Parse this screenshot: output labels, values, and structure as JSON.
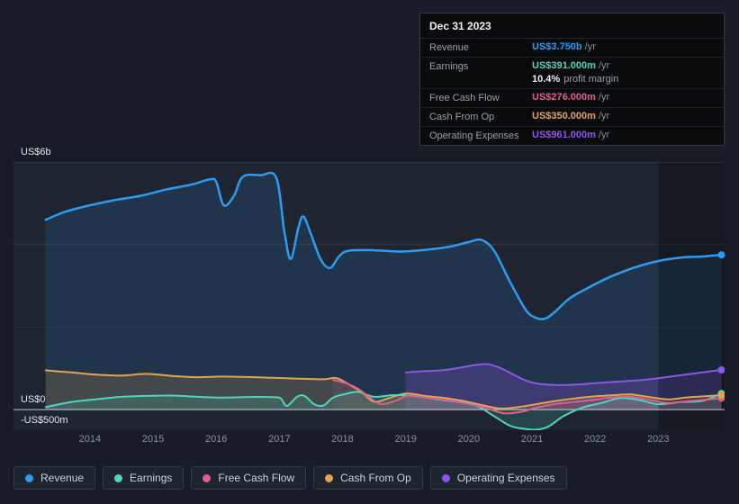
{
  "tooltip": {
    "title": "Dec 31 2023",
    "rows": [
      {
        "label": "Revenue",
        "value": "US$3.750b",
        "suffix": "/yr"
      },
      {
        "label": "Earnings",
        "value": "US$391.000m",
        "suffix": "/yr"
      },
      {
        "label": "Free Cash Flow",
        "value": "US$276.000m",
        "suffix": "/yr"
      },
      {
        "label": "Cash From Op",
        "value": "US$350.000m",
        "suffix": "/yr"
      },
      {
        "label": "Operating Expenses",
        "value": "US$961.000m",
        "suffix": "/yr"
      }
    ],
    "margin_value": "10.4%",
    "margin_label": "profit margin"
  },
  "chart_data": {
    "type": "area",
    "title": "",
    "x_range": [
      2012.79,
      2024.05
    ],
    "y_range_millions": [
      -500,
      6000
    ],
    "x_label_ticks": [
      "2014",
      "2015",
      "2016",
      "2017",
      "2018",
      "2019",
      "2020",
      "2021",
      "2022",
      "2023"
    ],
    "y_ticks": [
      {
        "value": 6000,
        "label": "US$6b"
      },
      {
        "value": 0,
        "label": "US$0"
      },
      {
        "value": -500,
        "label": "-US$500m"
      }
    ],
    "gridlines": [
      {
        "value": 6000,
        "color": "rgba(255,255,255,0.22)"
      },
      {
        "value": 4000,
        "color": "rgba(255,255,255,0.10)"
      },
      {
        "value": 2000,
        "color": "rgba(255,255,255,0.06)"
      },
      {
        "value": 0,
        "color": "rgba(255,255,255,0.75)",
        "emphasis": true
      }
    ],
    "shade_start": 2023.0,
    "shade_color": "rgba(0,0,0,0.28)",
    "legend_position": "bottom",
    "draw_order": [
      0,
      4,
      3,
      1,
      2
    ],
    "series": [
      {
        "name": "Revenue",
        "color": "#2e9bf2",
        "fill": "rgba(46,135,220,0.16)",
        "width": 2.5,
        "unit": "US$m",
        "points": [
          [
            2013.3,
            4600
          ],
          [
            2013.6,
            4790
          ],
          [
            2014,
            4950
          ],
          [
            2014.4,
            5080
          ],
          [
            2014.8,
            5180
          ],
          [
            2015.2,
            5330
          ],
          [
            2015.6,
            5450
          ],
          [
            2015.9,
            5580
          ],
          [
            2016.0,
            5520
          ],
          [
            2016.12,
            4950
          ],
          [
            2016.28,
            5180
          ],
          [
            2016.42,
            5640
          ],
          [
            2016.7,
            5680
          ],
          [
            2016.95,
            5620
          ],
          [
            2017.08,
            4300
          ],
          [
            2017.18,
            3650
          ],
          [
            2017.3,
            4400
          ],
          [
            2017.38,
            4680
          ],
          [
            2017.5,
            4250
          ],
          [
            2017.65,
            3650
          ],
          [
            2017.8,
            3430
          ],
          [
            2017.95,
            3720
          ],
          [
            2018.1,
            3850
          ],
          [
            2018.5,
            3860
          ],
          [
            2018.9,
            3830
          ],
          [
            2019.3,
            3870
          ],
          [
            2019.7,
            3950
          ],
          [
            2020.0,
            4060
          ],
          [
            2020.2,
            4110
          ],
          [
            2020.4,
            3850
          ],
          [
            2020.65,
            3100
          ],
          [
            2020.9,
            2420
          ],
          [
            2021.05,
            2230
          ],
          [
            2021.2,
            2200
          ],
          [
            2021.35,
            2350
          ],
          [
            2021.6,
            2700
          ],
          [
            2021.9,
            2960
          ],
          [
            2022.2,
            3190
          ],
          [
            2022.6,
            3430
          ],
          [
            2023.0,
            3600
          ],
          [
            2023.4,
            3690
          ],
          [
            2023.7,
            3710
          ],
          [
            2024.0,
            3750
          ]
        ]
      },
      {
        "name": "Earnings",
        "color": "#50d5bd",
        "fill": "rgba(80,213,189,0.18)",
        "width": 2,
        "unit": "US$m",
        "points": [
          [
            2013.3,
            60
          ],
          [
            2013.7,
            180
          ],
          [
            2014.1,
            250
          ],
          [
            2014.5,
            310
          ],
          [
            2014.9,
            330
          ],
          [
            2015.3,
            340
          ],
          [
            2015.7,
            310
          ],
          [
            2016.1,
            290
          ],
          [
            2016.5,
            305
          ],
          [
            2016.9,
            300
          ],
          [
            2017.02,
            270
          ],
          [
            2017.12,
            90
          ],
          [
            2017.28,
            310
          ],
          [
            2017.4,
            330
          ],
          [
            2017.55,
            130
          ],
          [
            2017.7,
            100
          ],
          [
            2017.85,
            290
          ],
          [
            2018.05,
            380
          ],
          [
            2018.25,
            430
          ],
          [
            2018.5,
            310
          ],
          [
            2018.8,
            350
          ],
          [
            2019.1,
            330
          ],
          [
            2019.45,
            260
          ],
          [
            2019.8,
            190
          ],
          [
            2020.1,
            110
          ],
          [
            2020.4,
            -160
          ],
          [
            2020.65,
            -390
          ],
          [
            2020.85,
            -460
          ],
          [
            2021.05,
            -490
          ],
          [
            2021.25,
            -420
          ],
          [
            2021.5,
            -160
          ],
          [
            2021.8,
            50
          ],
          [
            2022.1,
            160
          ],
          [
            2022.4,
            280
          ],
          [
            2022.7,
            230
          ],
          [
            2023,
            130
          ],
          [
            2023.35,
            180
          ],
          [
            2023.7,
            210
          ],
          [
            2024,
            391
          ]
        ]
      },
      {
        "name": "Free Cash Flow",
        "color": "#dd5f8d",
        "fill": "rgba(221,95,141,0.10)",
        "width": 2,
        "unit": "US$m",
        "points": [
          [
            2017.85,
            720
          ],
          [
            2018.05,
            640
          ],
          [
            2018.25,
            500
          ],
          [
            2018.45,
            270
          ],
          [
            2018.62,
            130
          ],
          [
            2018.85,
            220
          ],
          [
            2019.05,
            340
          ],
          [
            2019.35,
            280
          ],
          [
            2019.65,
            230
          ],
          [
            2019.95,
            150
          ],
          [
            2020.25,
            50
          ],
          [
            2020.55,
            -90
          ],
          [
            2020.85,
            -50
          ],
          [
            2021.05,
            40
          ],
          [
            2021.35,
            130
          ],
          [
            2021.65,
            180
          ],
          [
            2021.95,
            230
          ],
          [
            2022.25,
            290
          ],
          [
            2022.55,
            310
          ],
          [
            2022.85,
            240
          ],
          [
            2023.15,
            160
          ],
          [
            2023.45,
            200
          ],
          [
            2023.75,
            240
          ],
          [
            2024,
            276
          ]
        ]
      },
      {
        "name": "Cash From Op",
        "color": "#e3a44f",
        "fill": "rgba(227,164,79,0.18)",
        "width": 2,
        "unit": "US$m",
        "points": [
          [
            2013.3,
            950
          ],
          [
            2013.7,
            900
          ],
          [
            2014.1,
            845
          ],
          [
            2014.5,
            825
          ],
          [
            2014.9,
            865
          ],
          [
            2015.3,
            815
          ],
          [
            2015.7,
            785
          ],
          [
            2016.1,
            800
          ],
          [
            2016.5,
            790
          ],
          [
            2016.9,
            770
          ],
          [
            2017.3,
            750
          ],
          [
            2017.7,
            735
          ],
          [
            2017.9,
            765
          ],
          [
            2018.1,
            610
          ],
          [
            2018.3,
            430
          ],
          [
            2018.5,
            190
          ],
          [
            2018.72,
            270
          ],
          [
            2019.0,
            390
          ],
          [
            2019.3,
            330
          ],
          [
            2019.6,
            285
          ],
          [
            2019.9,
            210
          ],
          [
            2020.2,
            110
          ],
          [
            2020.5,
            25
          ],
          [
            2020.8,
            65
          ],
          [
            2021.05,
            125
          ],
          [
            2021.35,
            205
          ],
          [
            2021.65,
            265
          ],
          [
            2021.95,
            315
          ],
          [
            2022.25,
            345
          ],
          [
            2022.55,
            365
          ],
          [
            2022.85,
            305
          ],
          [
            2023.15,
            245
          ],
          [
            2023.45,
            295
          ],
          [
            2023.75,
            325
          ],
          [
            2024,
            350
          ]
        ]
      },
      {
        "name": "Operating Expenses",
        "color": "#8f55ea",
        "fill": "rgba(143,85,234,0.25)",
        "width": 2,
        "unit": "US$m",
        "points": [
          [
            2019.0,
            900
          ],
          [
            2019.3,
            930
          ],
          [
            2019.6,
            955
          ],
          [
            2019.9,
            1025
          ],
          [
            2020.1,
            1080
          ],
          [
            2020.3,
            1100
          ],
          [
            2020.5,
            1005
          ],
          [
            2020.7,
            855
          ],
          [
            2020.9,
            705
          ],
          [
            2021.1,
            625
          ],
          [
            2021.4,
            595
          ],
          [
            2021.7,
            605
          ],
          [
            2022,
            640
          ],
          [
            2022.3,
            672
          ],
          [
            2022.6,
            700
          ],
          [
            2022.9,
            742
          ],
          [
            2023.2,
            800
          ],
          [
            2023.5,
            862
          ],
          [
            2023.8,
            922
          ],
          [
            2024,
            961
          ]
        ]
      }
    ]
  }
}
